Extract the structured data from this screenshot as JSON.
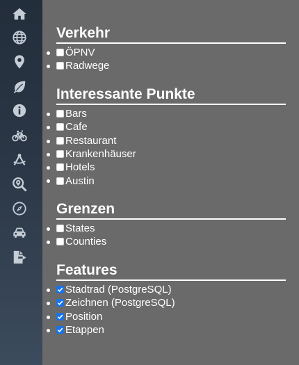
{
  "sidebar": {
    "items": [
      {
        "icon": "home-icon"
      },
      {
        "icon": "globe-icon"
      },
      {
        "icon": "map-marker-icon"
      },
      {
        "icon": "leaf-icon"
      },
      {
        "icon": "info-icon"
      },
      {
        "icon": "bicycle-icon"
      },
      {
        "icon": "drafting-compass-icon"
      },
      {
        "icon": "search-location-icon"
      },
      {
        "icon": "compass-icon"
      },
      {
        "icon": "car-icon"
      },
      {
        "icon": "file-export-icon"
      }
    ]
  },
  "sections": [
    {
      "title": "Verkehr",
      "items": [
        {
          "label": "ÖPNV",
          "checked": false
        },
        {
          "label": "Radwege",
          "checked": false
        }
      ]
    },
    {
      "title": "Interessante Punkte",
      "items": [
        {
          "label": "Bars",
          "checked": false
        },
        {
          "label": "Cafe",
          "checked": false
        },
        {
          "label": "Restaurant",
          "checked": false
        },
        {
          "label": "Krankenhäuser",
          "checked": false
        },
        {
          "label": "Hotels",
          "checked": false
        },
        {
          "label": "Austin",
          "checked": false
        }
      ]
    },
    {
      "title": "Grenzen",
      "items": [
        {
          "label": "States",
          "checked": false
        },
        {
          "label": "Counties",
          "checked": false
        }
      ]
    },
    {
      "title": "Features",
      "items": [
        {
          "label": "Stadtrad (PostgreSQL)",
          "checked": true
        },
        {
          "label": "Zeichnen (PostgreSQL)",
          "checked": true
        },
        {
          "label": "Position",
          "checked": true
        },
        {
          "label": "Etappen",
          "checked": true
        }
      ]
    }
  ],
  "colors": {
    "panel_bg": "#6a6a6a",
    "sidebar_top": "#232e3b",
    "sidebar_bottom": "#3c4b5d",
    "icon": "#c4ccd6",
    "checkbox_accent": "#1a73e8",
    "text": "#ffffff"
  }
}
